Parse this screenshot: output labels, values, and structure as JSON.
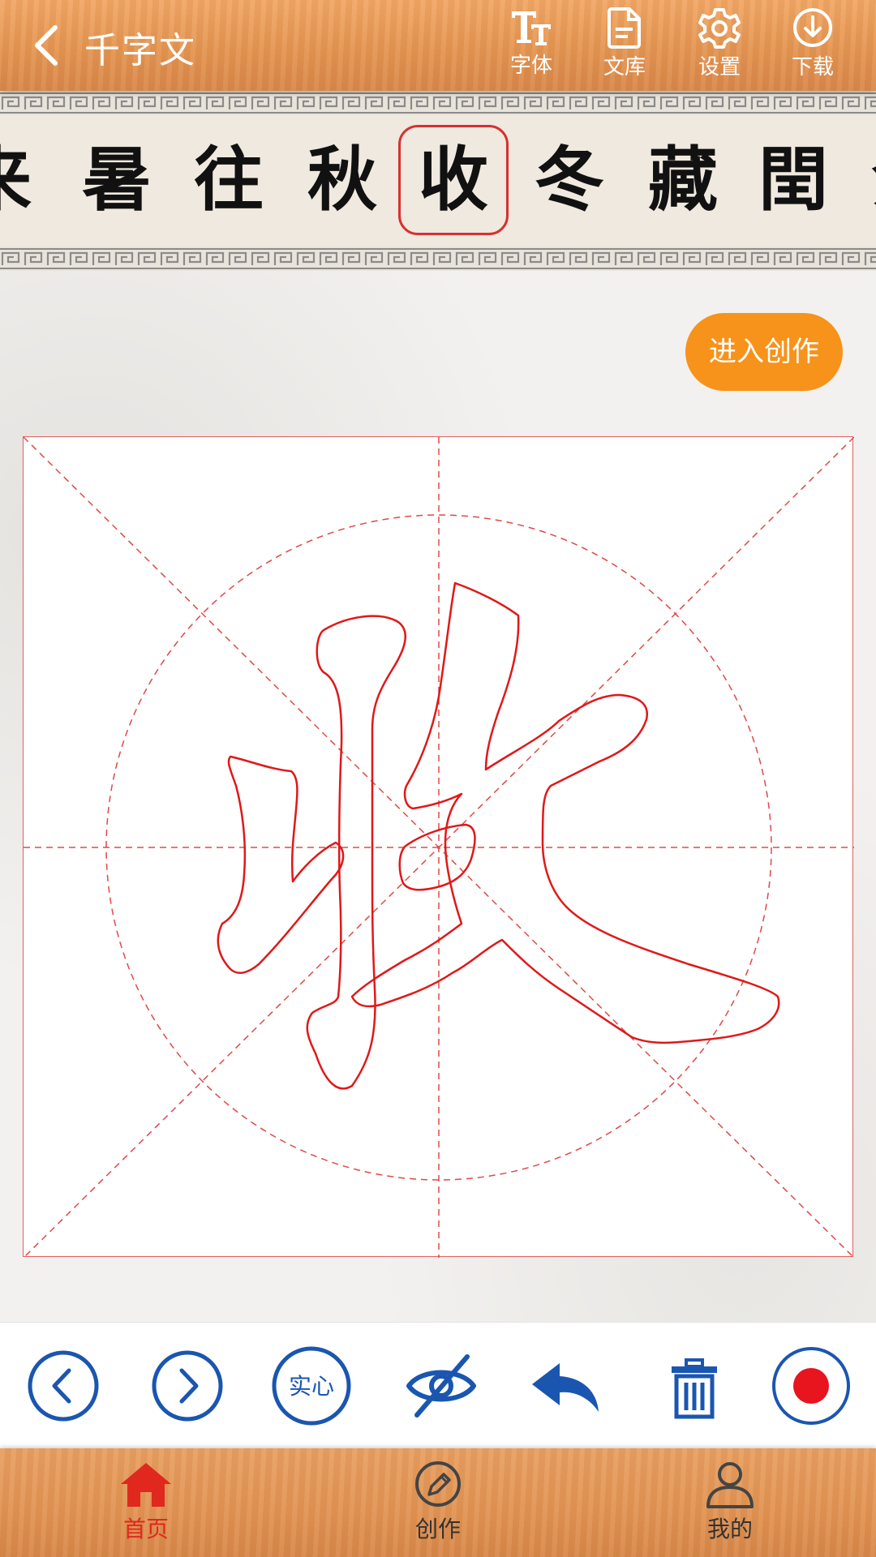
{
  "header": {
    "title": "千字文",
    "tools": [
      {
        "label": "字体",
        "icon": "font-icon"
      },
      {
        "label": "文库",
        "icon": "document-icon"
      },
      {
        "label": "设置",
        "icon": "gear-icon"
      },
      {
        "label": "下载",
        "icon": "download-icon"
      }
    ]
  },
  "characters": [
    "来",
    "暑",
    "往",
    "秋",
    "收",
    "冬",
    "藏",
    "閏",
    "余"
  ],
  "selected_character": "收",
  "main": {
    "create_button": "进入创作"
  },
  "controls": {
    "solid_label": "实心"
  },
  "colors": {
    "accent_orange": "#f7931a",
    "control_blue": "#1a56b0",
    "record_red": "#e8141e",
    "grid_red": "#e04848",
    "active_nav": "#e0281e"
  },
  "bottom_nav": [
    {
      "label": "首页",
      "icon": "home-icon",
      "active": true
    },
    {
      "label": "创作",
      "icon": "pencil-icon",
      "active": false
    },
    {
      "label": "我的",
      "icon": "user-icon",
      "active": false
    }
  ]
}
